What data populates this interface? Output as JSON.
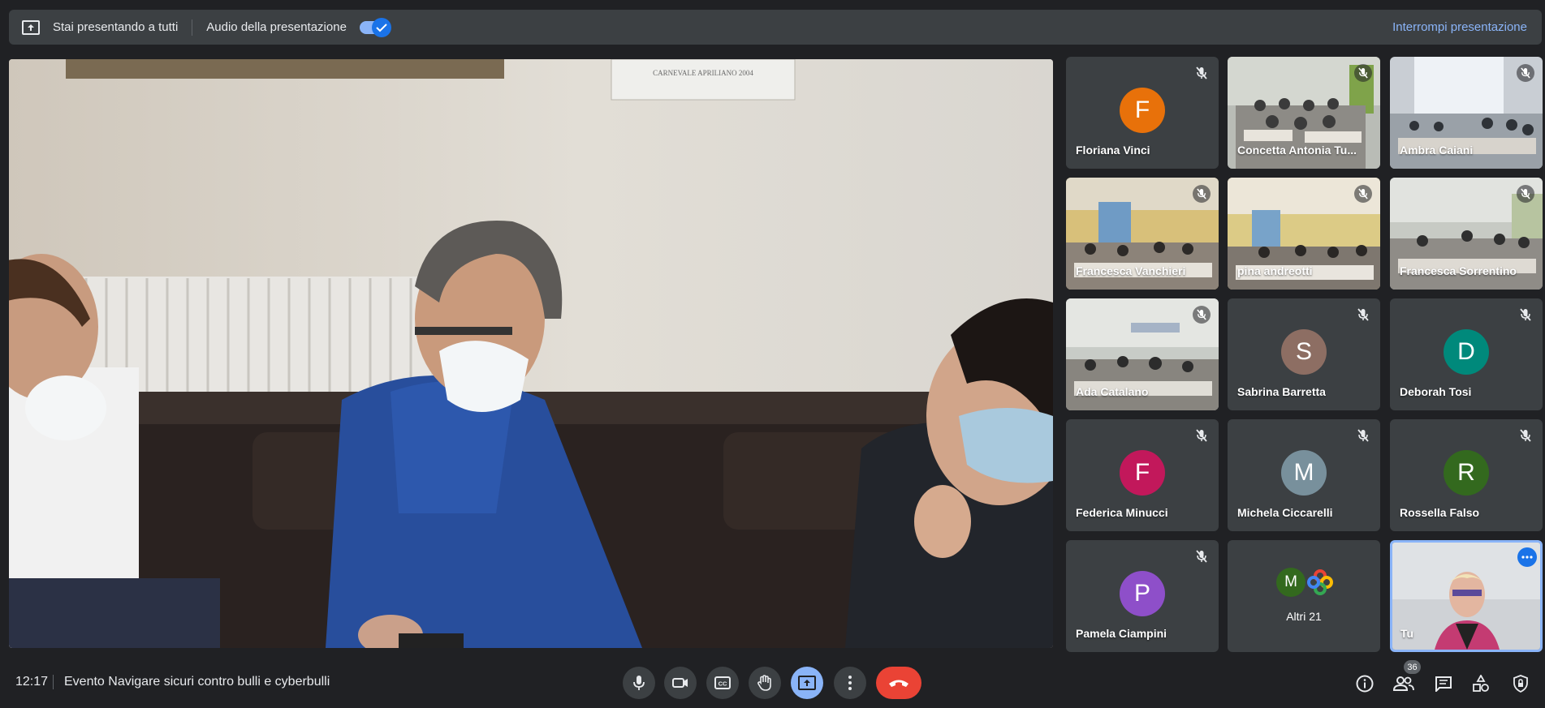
{
  "topbar": {
    "presenting_text": "Stai presentando a tutti",
    "audio_text": "Audio della presentazione",
    "stop_label": "Interrompi presentazione"
  },
  "main_video": {
    "poster_text": "CARNEVALE APRILIANO 2004"
  },
  "participants": [
    {
      "name": "Floriana Vinci",
      "initial": "F",
      "color": "#e8710a"
    },
    {
      "name": "Concetta Antonia Tu...",
      "initial": "",
      "color": ""
    },
    {
      "name": "Ambra Caiani",
      "initial": "",
      "color": ""
    },
    {
      "name": "Francesca Vanchieri",
      "initial": "",
      "color": ""
    },
    {
      "name": "pina andreotti",
      "initial": "",
      "color": ""
    },
    {
      "name": "Francesca Sorrentino",
      "initial": "",
      "color": ""
    },
    {
      "name": "Ada Catalano",
      "initial": "",
      "color": ""
    },
    {
      "name": "Sabrina Barretta",
      "initial": "S",
      "color": "#8d6e63"
    },
    {
      "name": "Deborah Tosi",
      "initial": "D",
      "color": "#00897b"
    },
    {
      "name": "Federica Minucci",
      "initial": "F",
      "color": "#c2185b"
    },
    {
      "name": "Michela Ciccarelli",
      "initial": "M",
      "color": "#78909c"
    },
    {
      "name": "Rossella Falso",
      "initial": "R",
      "color": "#33691e"
    },
    {
      "name": "Pamela Ciampini",
      "initial": "P",
      "color": "#8e4fc9"
    }
  ],
  "others": {
    "label": "Altri 21",
    "initial": "M",
    "color": "#33691e"
  },
  "self_tile": {
    "label": "Tu"
  },
  "bottombar": {
    "time": "12:17",
    "meeting_title": "Evento Navigare sicuri contro bulli e cyberbulli",
    "participants_count": "36"
  }
}
